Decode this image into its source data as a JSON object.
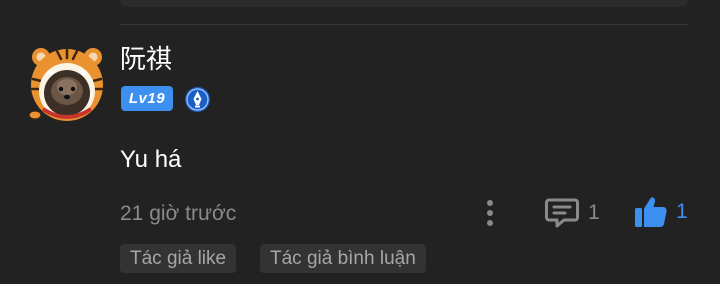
{
  "comment": {
    "username": "阮祺",
    "level": "Lv19",
    "text": "Yu há",
    "timestamp": "21 giờ trước",
    "reply_count": "1",
    "like_count": "1",
    "tags": [
      "Tác giả like",
      "Tác giả bình luận"
    ]
  },
  "icons": {
    "avatar": "tiger-hood-dog-avatar",
    "honor": "pen-nib-badge-icon",
    "more": "vertical-dots-icon",
    "reply": "comment-bubble-icon",
    "like": "thumbs-up-icon"
  },
  "colors": {
    "background": "#222222",
    "accent": "#3d8ff0",
    "muted_text": "#8a8a8a",
    "tag_background": "#333333"
  }
}
